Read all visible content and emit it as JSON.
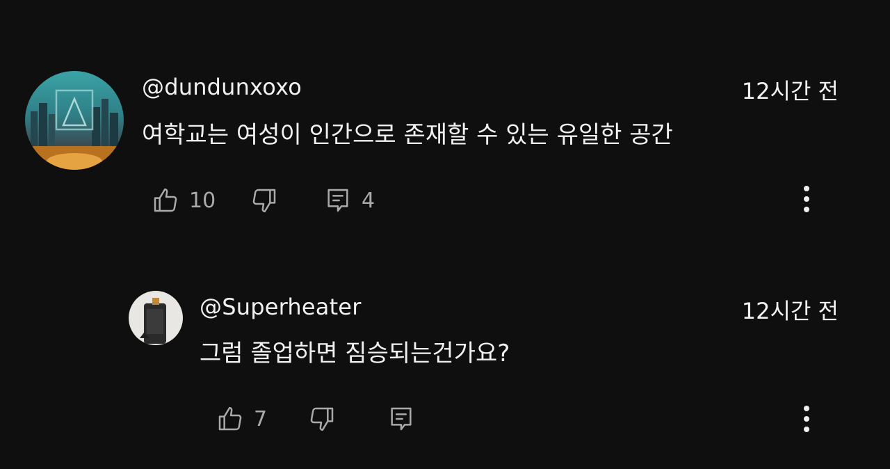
{
  "comments": [
    {
      "handle": "@dundunxoxo",
      "time": "12시간 전",
      "text": "여학교는 여성이 인간으로 존재할 수 있는 유일한 공간",
      "likes": "10",
      "replies": "4",
      "avatar_icon": "city-skyline-avatar"
    },
    {
      "handle": "@Superheater",
      "time": "12시간 전",
      "text": "그럼 졸업하면 짐승되는건가요?",
      "likes": "7",
      "replies": "",
      "avatar_icon": "device-photo-avatar"
    }
  ],
  "icons": {
    "like": "thumbs-up-icon",
    "dislike": "thumbs-down-icon",
    "reply": "reply-comment-icon",
    "more": "more-vert-icon"
  },
  "colors": {
    "background": "#0f0f0f",
    "text": "#f1f1f1",
    "secondary": "#aaaaaa"
  }
}
